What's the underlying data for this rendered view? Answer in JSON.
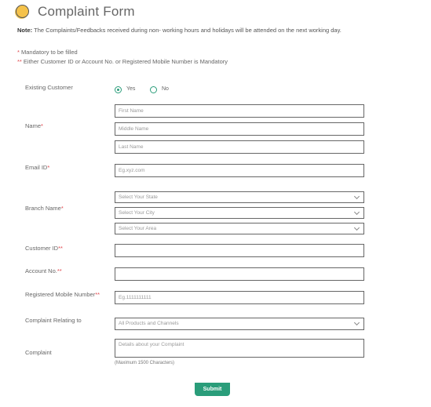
{
  "header": {
    "icon": "circle-bullet-icon",
    "title": "Complaint Form"
  },
  "note": {
    "label": "Note:",
    "text": " The Complaints/Feedbacks received during non- working hours and holidays will be attended on the next working day."
  },
  "mandatory": {
    "single_star": "*",
    "single_text": " Mandatory to be filled",
    "double_star": "**",
    "double_text": " Either Customer ID or Account No. or Registered Mobile Number is Mandatory"
  },
  "form": {
    "existing_customer": {
      "label": "Existing Customer",
      "options": [
        "Yes",
        "No"
      ],
      "selected": "Yes"
    },
    "name": {
      "label": "Name",
      "marker": "*",
      "first_placeholder": "First Name",
      "middle_placeholder": "Middle Name",
      "last_placeholder": "Last Name"
    },
    "email": {
      "label": "Email ID",
      "marker": "*",
      "placeholder": "Eg.xyz.com"
    },
    "branch": {
      "label": "Branch Name",
      "marker": "*",
      "state": "Select Your State",
      "city": "Select Your City",
      "area": "Select Your Area"
    },
    "customer_id": {
      "label": "Customer ID",
      "marker": "**",
      "value": ""
    },
    "account_no": {
      "label": "Account No.",
      "marker": "**",
      "value": ""
    },
    "mobile": {
      "label": "Registered Mobile Number",
      "marker": "**",
      "placeholder": "Eg.1111111111"
    },
    "relating_to": {
      "label": "Complaint Relating to",
      "selected": "All Products and Channels"
    },
    "complaint": {
      "label": "Complaint",
      "placeholder": "Details about your Complaint",
      "hint": "(Maximum 1500 Characters)"
    },
    "submit_label": "Submit"
  },
  "colors": {
    "accent": "#2a9d7a",
    "required": "#e0474c",
    "title_icon": "#f5c24a"
  }
}
